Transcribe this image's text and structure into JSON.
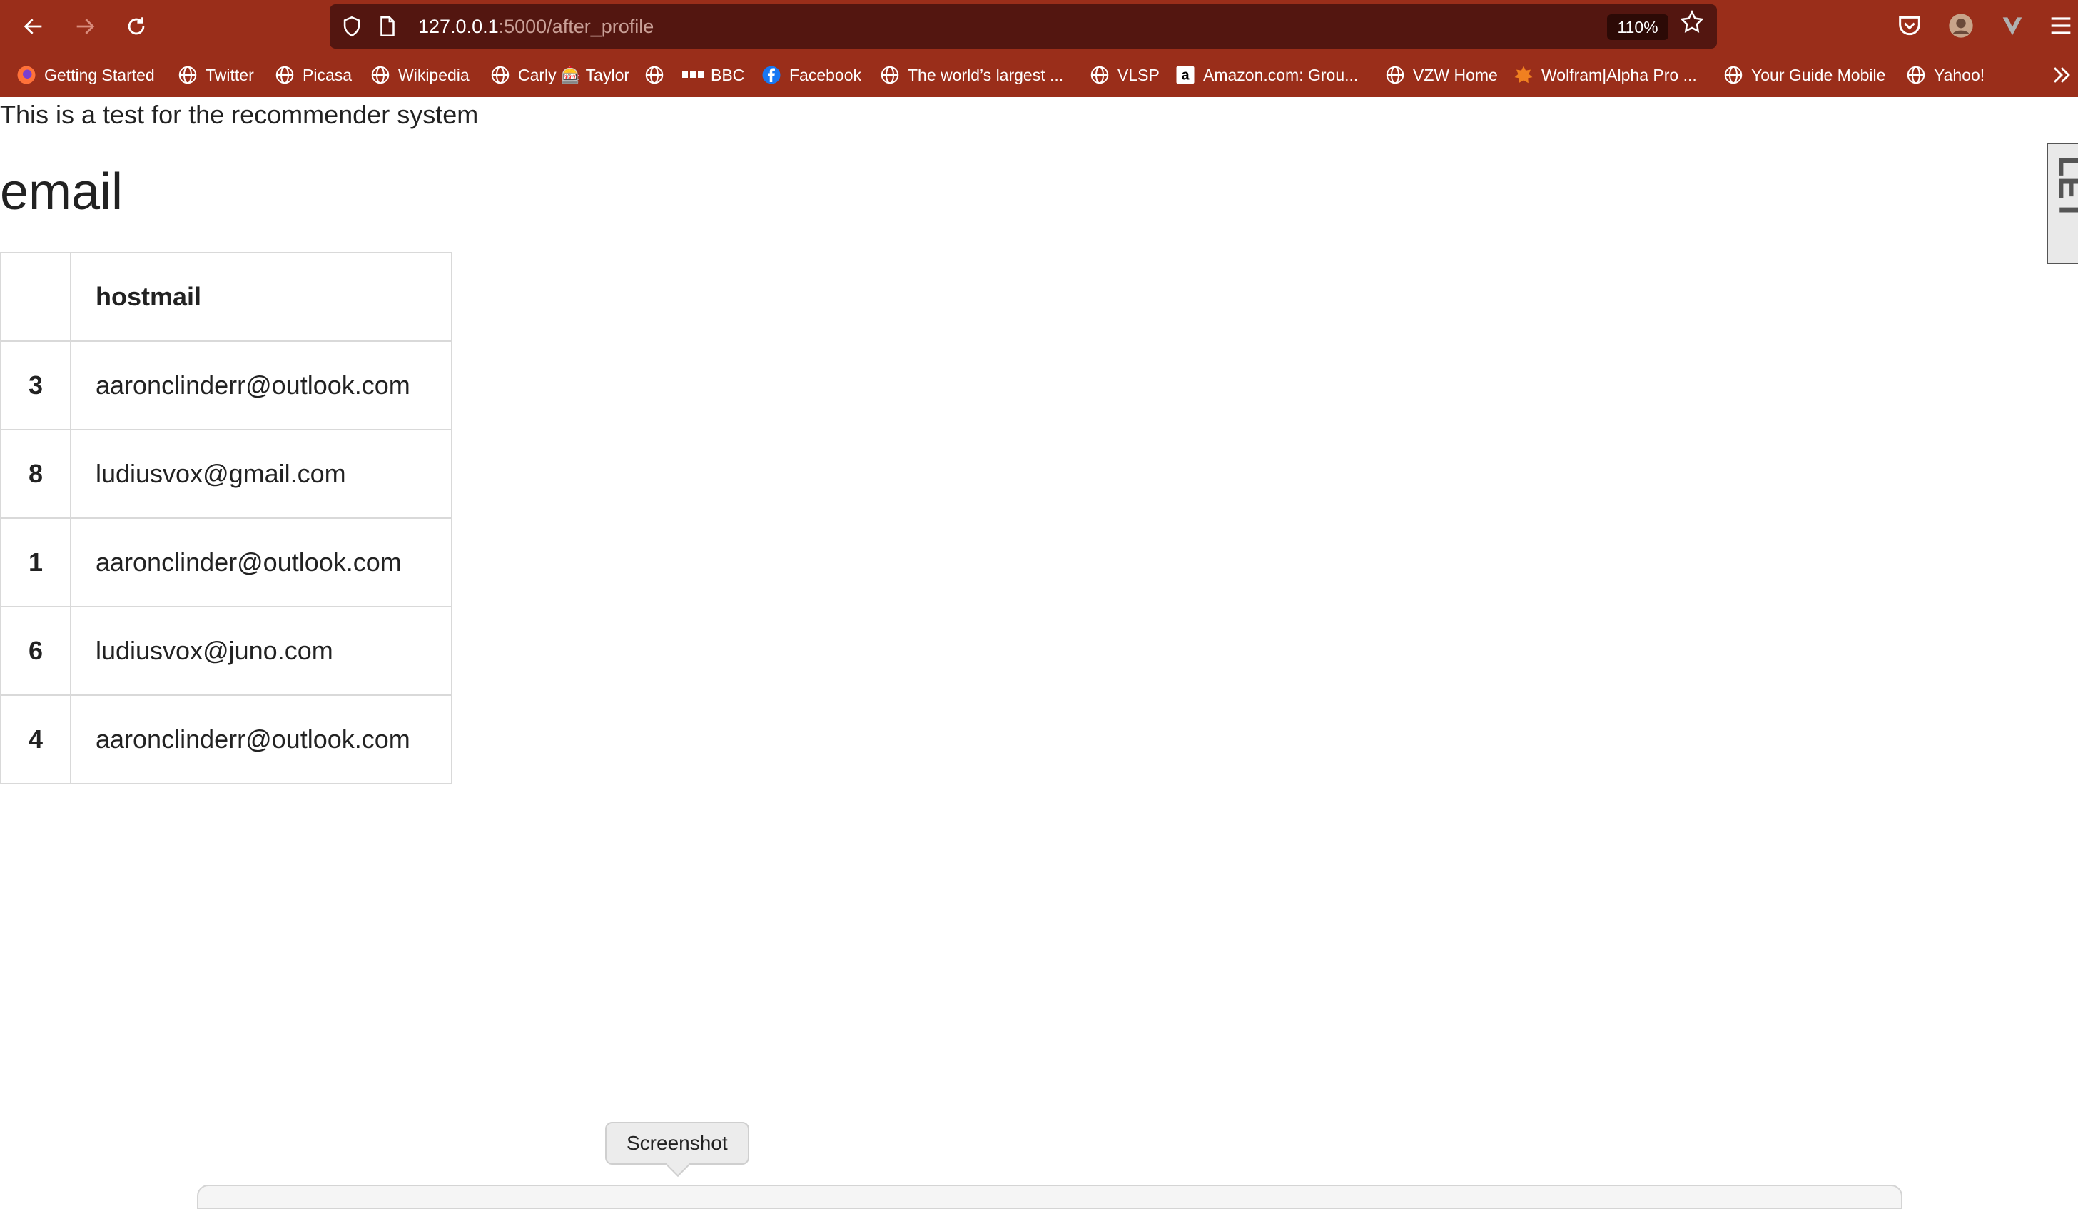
{
  "browser": {
    "url_host": "127.0.0.1",
    "url_path": ":5000/after_profile",
    "zoom": "110%",
    "bookmarks": [
      {
        "label": "Getting Started",
        "icon": "firefox-icon"
      },
      {
        "label": "Twitter",
        "icon": "globe-icon"
      },
      {
        "label": "Picasa",
        "icon": "globe-icon"
      },
      {
        "label": "Wikipedia",
        "icon": "globe-icon"
      },
      {
        "label": "Carly 🎰 Taylor",
        "icon": "globe-icon"
      },
      {
        "label": "",
        "icon": "globe-icon"
      },
      {
        "label": "BBC",
        "icon": "bbc-icon"
      },
      {
        "label": "Facebook",
        "icon": "facebook-icon"
      },
      {
        "label": "The world’s largest ...",
        "icon": "globe-icon"
      },
      {
        "label": "VLSP",
        "icon": "globe-icon"
      },
      {
        "label": "Amazon.com: Grou...",
        "icon": "amazon-icon"
      },
      {
        "label": "VZW Home",
        "icon": "globe-icon"
      },
      {
        "label": "Wolfram|Alpha Pro ...",
        "icon": "wolfram-icon"
      },
      {
        "label": "Your Guide Mobile",
        "icon": "globe-icon"
      },
      {
        "label": "Yahoo!",
        "icon": "globe-icon"
      }
    ]
  },
  "page": {
    "intro": "This is a test for the recommender system",
    "heading": "email",
    "table": {
      "header": {
        "index": "",
        "column": "hostmail"
      },
      "rows": [
        {
          "index": "3",
          "value": "aaronclinderr@outlook.com"
        },
        {
          "index": "8",
          "value": "ludiusvox@gmail.com"
        },
        {
          "index": "1",
          "value": "aaronclinder@outlook.com"
        },
        {
          "index": "6",
          "value": "ludiusvox@juno.com"
        },
        {
          "index": "4",
          "value": "aaronclinderr@outlook.com"
        }
      ]
    },
    "side_widget_text": "LET"
  },
  "tooltip": "Screenshot",
  "colors": {
    "toolbar": "#9a2e1a",
    "urlbar": "#531610",
    "text": "#222222"
  }
}
